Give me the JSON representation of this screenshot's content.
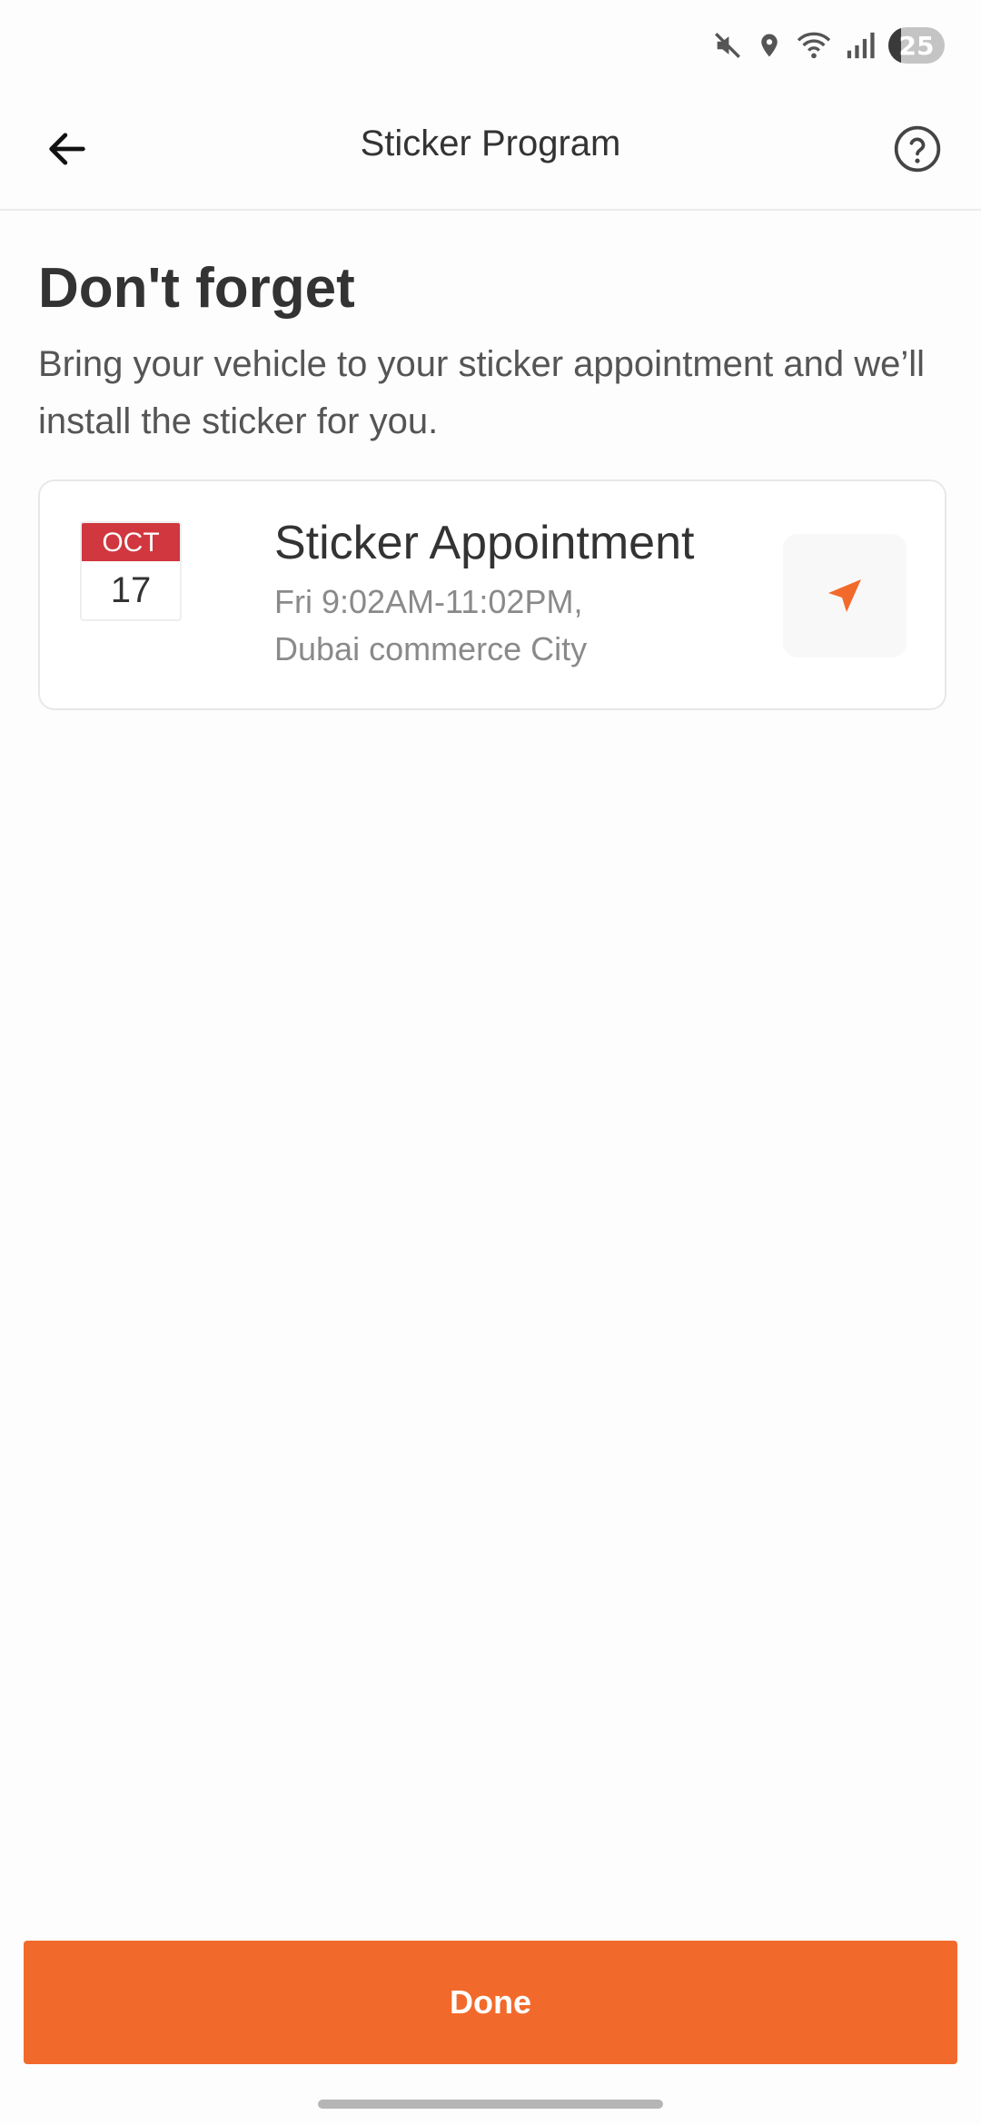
{
  "status_bar": {
    "icons": [
      "mute-icon",
      "location-icon",
      "wifi-icon",
      "signal-icon"
    ],
    "battery_level": "25"
  },
  "app_bar": {
    "title": "Sticker Program",
    "back_icon": "arrow-left-icon",
    "help_icon": "help-circle-icon"
  },
  "main": {
    "heading": "Don't forget",
    "subtext": "Bring your vehicle to your sticker appointment and we’ll install the sticker for you."
  },
  "appointment": {
    "month": "OCT",
    "day": "17",
    "title": "Sticker Appointment",
    "time": "Fri 9:02AM-11:02PM,",
    "location": "Dubai commerce City",
    "nav_icon": "navigation-arrow-icon"
  },
  "footer": {
    "done_label": "Done"
  },
  "colors": {
    "accent": "#f26a2b",
    "calendar_red": "#d0373f"
  }
}
